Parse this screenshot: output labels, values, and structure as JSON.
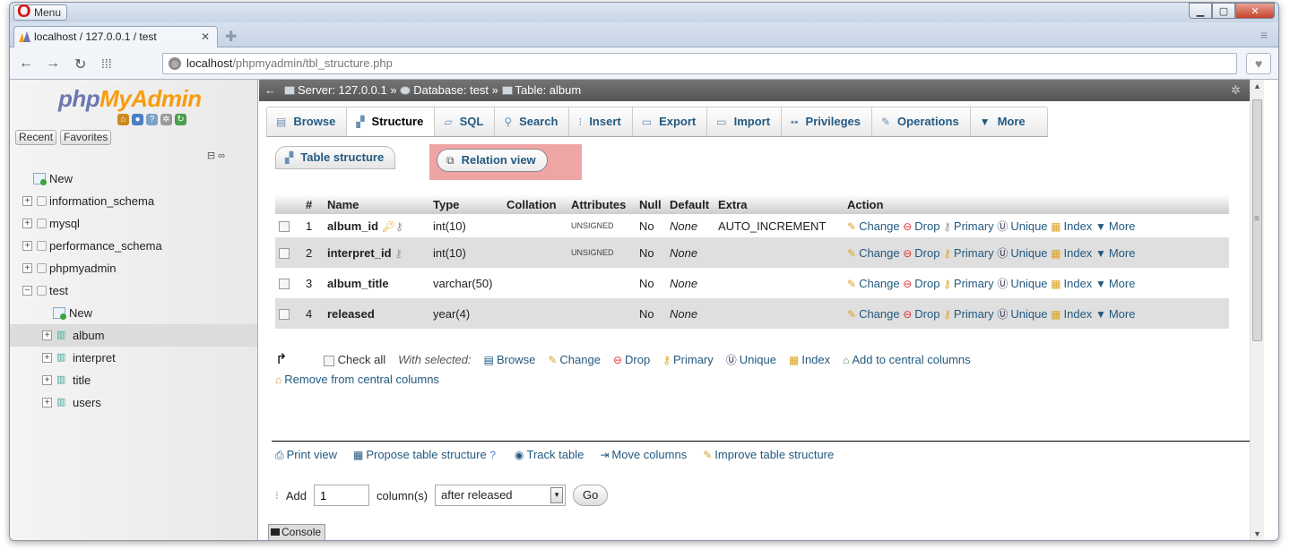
{
  "browser": {
    "menu_label": "Menu",
    "tab_title": "localhost / 127.0.0.1 / test",
    "tab_close": "✕",
    "url_host": "localhost",
    "url_path": "/phpmyadmin/tbl_structure.php"
  },
  "sidebar": {
    "logo_php": "php",
    "logo_myadmin": "MyAdmin",
    "recent": "Recent",
    "favorites": "Favorites",
    "tree": [
      {
        "label": "New"
      },
      {
        "label": "information_schema"
      },
      {
        "label": "mysql"
      },
      {
        "label": "performance_schema"
      },
      {
        "label": "phpmyadmin"
      },
      {
        "label": "test"
      },
      {
        "label": "New"
      },
      {
        "label": "album"
      },
      {
        "label": "interpret"
      },
      {
        "label": "title"
      },
      {
        "label": "users"
      }
    ]
  },
  "breadcrumb": {
    "server": "Server: 127.0.0.1 »",
    "database": "Database: test »",
    "table": "Table: album"
  },
  "tabs": [
    {
      "label": "Browse"
    },
    {
      "label": "Structure"
    },
    {
      "label": "SQL"
    },
    {
      "label": "Search"
    },
    {
      "label": "Insert"
    },
    {
      "label": "Export"
    },
    {
      "label": "Import"
    },
    {
      "label": "Privileges"
    },
    {
      "label": "Operations"
    },
    {
      "label": "More"
    }
  ],
  "subtabs": {
    "table_structure": "Table structure",
    "relation_view": "Relation view"
  },
  "table": {
    "headers": [
      "#",
      "Name",
      "Type",
      "Collation",
      "Attributes",
      "Null",
      "Default",
      "Extra",
      "Action"
    ],
    "rows": [
      {
        "num": "1",
        "name": "album_id",
        "type": "int(10)",
        "collation": "",
        "attributes": "UNSIGNED",
        "null": "No",
        "default": "None",
        "extra": "AUTO_INCREMENT"
      },
      {
        "num": "2",
        "name": "interpret_id",
        "type": "int(10)",
        "collation": "",
        "attributes": "UNSIGNED",
        "null": "No",
        "default": "None",
        "extra": ""
      },
      {
        "num": "3",
        "name": "album_title",
        "type": "varchar(50)",
        "collation": "",
        "attributes": "",
        "null": "No",
        "default": "None",
        "extra": ""
      },
      {
        "num": "4",
        "name": "released",
        "type": "year(4)",
        "collation": "",
        "attributes": "",
        "null": "No",
        "default": "None",
        "extra": ""
      }
    ],
    "actions": {
      "change": "Change",
      "drop": "Drop",
      "primary": "Primary",
      "unique": "Unique",
      "index": "Index",
      "more": "More"
    }
  },
  "with_selected": {
    "check_all": "Check all",
    "label": "With selected:",
    "browse": "Browse",
    "change": "Change",
    "drop": "Drop",
    "primary": "Primary",
    "unique": "Unique",
    "index": "Index",
    "add_central": "Add to central columns",
    "remove_central": "Remove from central columns"
  },
  "tools": {
    "print_view": "Print view",
    "propose": "Propose table structure",
    "track": "Track table",
    "move": "Move columns",
    "improve": "Improve table structure"
  },
  "add_columns": {
    "label": "Add",
    "count": "1",
    "columns_label": "column(s)",
    "position": "after released",
    "go": "Go"
  },
  "console": "Console",
  "colors": {
    "link": "#235a81",
    "highlight": "#f0a5a5",
    "logo_php": "#6c78af",
    "logo_myadmin": "#f89c0e"
  }
}
